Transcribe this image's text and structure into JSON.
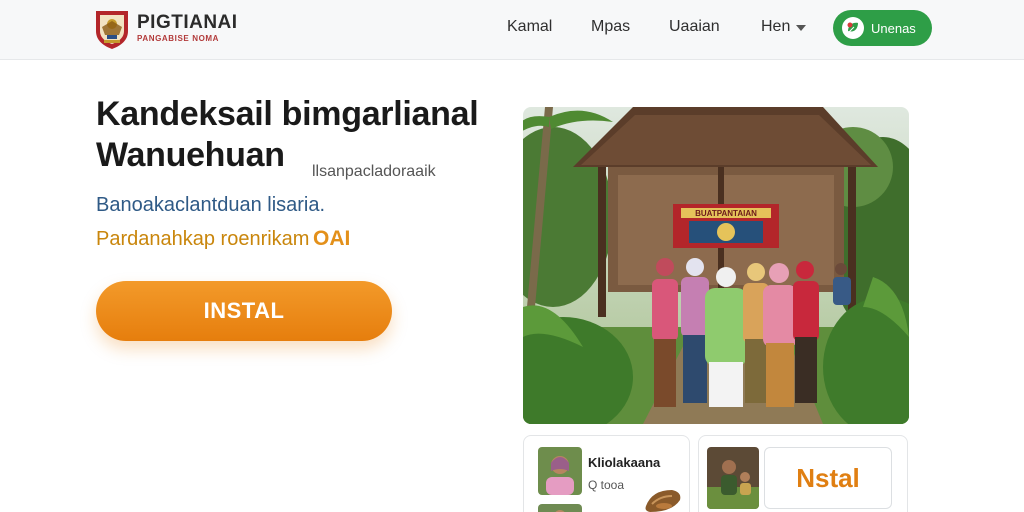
{
  "brand": {
    "title": "PIGTIANAI",
    "subtitle": "PANGABISE NOMA",
    "emblem_icon": "garuda-shield-emblem"
  },
  "nav": {
    "links": [
      "Kamal",
      "Mpas",
      "Uaaian",
      "Hen"
    ],
    "dropdown_icon": "chevron-down-icon",
    "cta_label": "Unenas",
    "cta_icon": "leaf-icon",
    "cta_color": "#2e9e47"
  },
  "hero": {
    "title": "Kandeksail bimgarlianal Wanuehuan",
    "aside": "llsanpacladoraaik",
    "subtitle": "Banoakaclantduan lisaria.",
    "promo": "Pardanahkap roenrikam",
    "promo_badge": "OAI",
    "install_label": "INSTAL",
    "accent_color": "#e8830f"
  },
  "photo": {
    "banner_text": "BUATPANTAIAN",
    "subject": "group-of-women-in-front-of-wooden-pavilion"
  },
  "cards": [
    {
      "title": "Kliolakaana",
      "meta": "Q tooa",
      "thumb": "woman-portrait-thumbnail",
      "extra_icon": "pastry-icon"
    },
    {
      "label": "Nstal",
      "thumb": "seated-group-thumbnail"
    }
  ]
}
